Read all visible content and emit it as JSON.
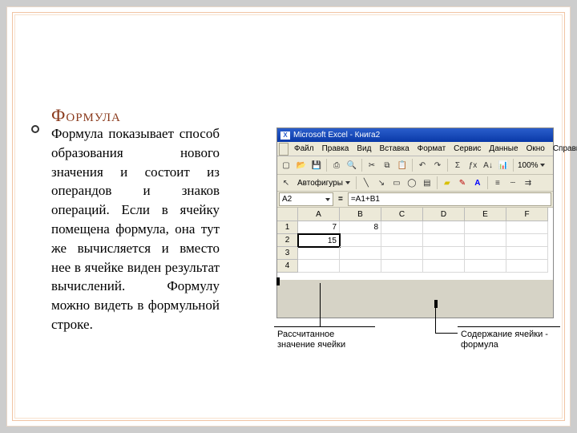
{
  "heading": "Формула",
  "body": "Формула показывает способ образования нового значения и состоит из операндов и знаков операций. Если в ячейку помещена формула, она тут же вычисляется и вместо нее в ячейке виден результат вычислений. Формулу можно видеть в формульной строке.",
  "shot": {
    "title": "Microsoft Excel - Книга2",
    "menu": [
      "Файл",
      "Правка",
      "Вид",
      "Вставка",
      "Формат",
      "Сервис",
      "Данные",
      "Окно",
      "Справка"
    ],
    "zoom": "100%",
    "shapes_label": "Автофигуры",
    "namebox": "A2",
    "formula": "=A1+B1",
    "columns": [
      "A",
      "B",
      "C",
      "D",
      "E",
      "F"
    ],
    "rows": [
      "1",
      "2",
      "3",
      "4"
    ],
    "cells": {
      "A1": "7",
      "B1": "8",
      "A2": "15"
    }
  },
  "callouts": {
    "left": "Рассчитанное значение ячейки",
    "right": "Содержание ячейки - формула"
  }
}
